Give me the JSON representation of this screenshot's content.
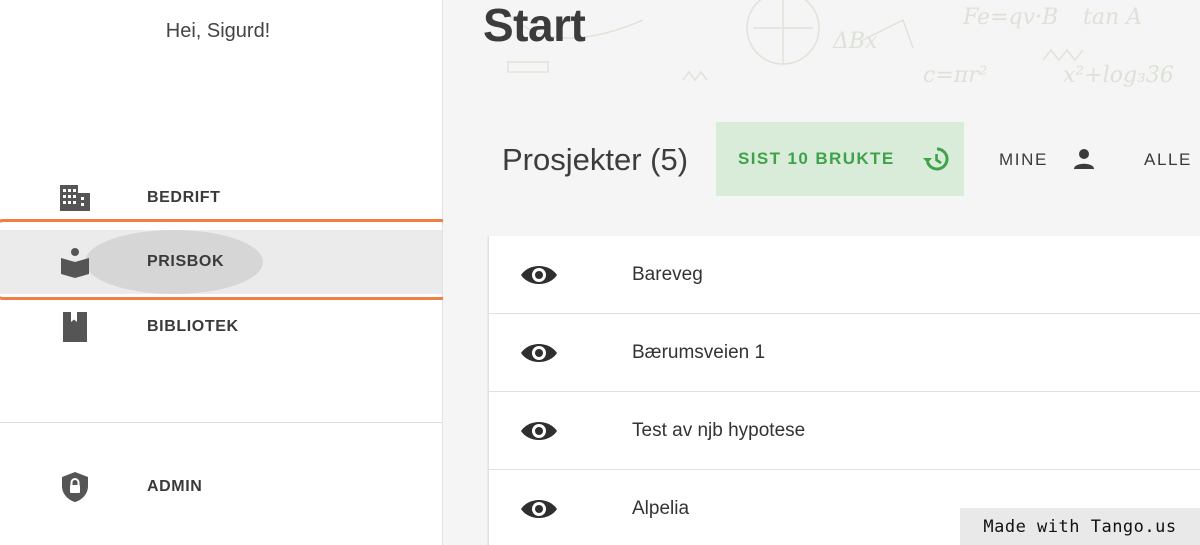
{
  "sidebar": {
    "greeting": "Hei, Sigurd!",
    "items": [
      {
        "label": "BEDRIFT",
        "icon": "building-icon"
      },
      {
        "label": "PRISBOK",
        "icon": "reader-icon"
      },
      {
        "label": "BIBLIOTEK",
        "icon": "book-icon"
      },
      {
        "label": "ADMIN",
        "icon": "shield-lock-icon"
      }
    ],
    "selected": "PRISBOK"
  },
  "main": {
    "title": "Start",
    "projects_heading": "Prosjekter (5)",
    "filters": [
      {
        "label": "SIST 10 BRUKTE",
        "icon": "history-icon",
        "active": true
      },
      {
        "label": "MINE",
        "icon": "person-icon",
        "active": false
      },
      {
        "label": "ALLE",
        "active": false
      }
    ],
    "projects": [
      {
        "name": "Bareveg",
        "icon": "eye-icon"
      },
      {
        "name": "Bærumsveien 1",
        "icon": "eye-icon"
      },
      {
        "name": "Test av njb hypotese",
        "icon": "eye-icon"
      },
      {
        "name": "Alpelia",
        "icon": "eye-icon"
      }
    ]
  },
  "watermark": "Made with Tango.us",
  "colors": {
    "accent_green": "#3fa24a",
    "active_filter_bg": "#d9ecd9",
    "highlight_orange": "#f07e45",
    "icon_gray": "#555555"
  }
}
